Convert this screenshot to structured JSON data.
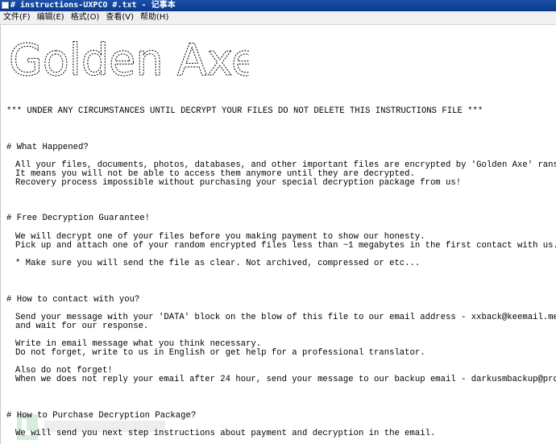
{
  "window": {
    "title": "# instructions-UXPCO #.txt - 记事本"
  },
  "menu": {
    "items": [
      "文件(F)",
      "编辑(E)",
      "格式(O)",
      "查看(V)",
      "帮助(H)"
    ]
  },
  "document": {
    "logo_text": "Golden Axe",
    "warning_line": "*** UNDER ANY CIRCUMSTANCES UNTIL DECRYPT YOUR FILES DO NOT DELETE THIS INSTRUCTIONS FILE ***",
    "sections": [
      {
        "heading": "# What Happened?",
        "lines": [
          "All your files, documents, photos, databases, and other important files are encrypted by 'Golden Axe' ransomware!",
          "It means you will not be able to access them anymore until they are decrypted.",
          "Recovery process impossible without purchasing your special decryption package from us!"
        ]
      },
      {
        "heading": "# Free Decryption Guarantee!",
        "lines": [
          "We will decrypt one of your files before you making payment to show our honesty.",
          "Pick up and attach one of your random encrypted files less than ~1 megabytes in the first contact with us.",
          "* Make sure you will send the file as clear. Not archived, compressed or etc..."
        ]
      },
      {
        "heading": "# How to contact with you?",
        "lines": [
          "Send your message with your 'DATA' block on the blow of this file to our email address - xxback@keemail.me",
          "and wait for our response.",
          "Write in email message what you think necessary.",
          "Do not forget, write to us in English or get help for a professional translator.",
          "Also do not forget!",
          "When we does not reply your email after 24 hour, send your message to our backup email - darkusmbackup@protonmail.com"
        ]
      },
      {
        "heading": "# How to Purchase Decryption Package?",
        "lines": [
          "We will send you next step instructions about payment and decryption in the email."
        ]
      }
    ]
  },
  "colors": {
    "titlebar": "#0a3a8c",
    "menubar": "#f0f0f0",
    "text": "#000000"
  }
}
